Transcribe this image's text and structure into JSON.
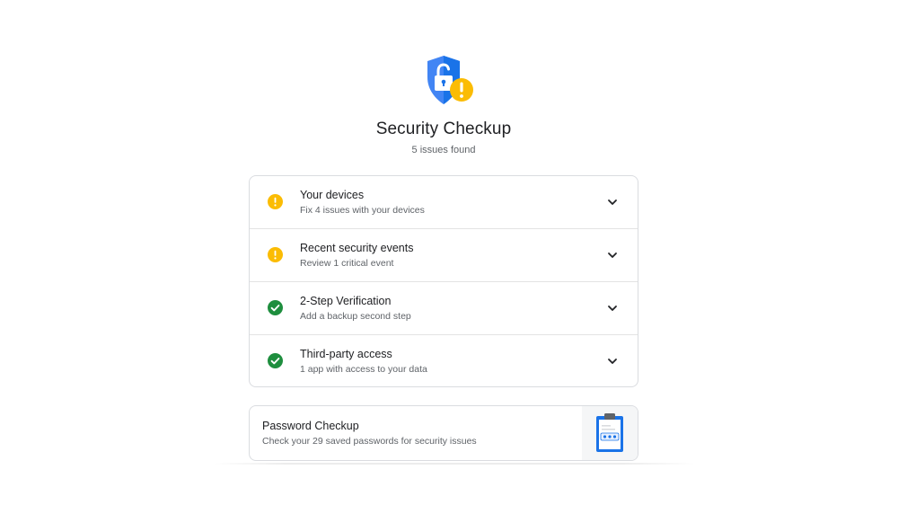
{
  "header": {
    "icon": "shield-lock-warning-icon",
    "title": "Security Checkup",
    "subtitle": "5 issues found"
  },
  "checks": [
    {
      "title": "Your devices",
      "description": "Fix 4 issues with your devices",
      "status": "warning"
    },
    {
      "title": "Recent security events",
      "description": "Review 1 critical event",
      "status": "warning"
    },
    {
      "title": "2-Step Verification",
      "description": "Add a backup second step",
      "status": "ok"
    },
    {
      "title": "Third-party access",
      "description": "1 app with access to your data",
      "status": "ok"
    }
  ],
  "password_checkup": {
    "title": "Password Checkup",
    "description": "Check your 29 saved passwords for security issues",
    "icon": "clipboard-password-icon"
  },
  "colors": {
    "warning": "#fbbc04",
    "ok": "#1e8e3e",
    "shield": "#1a73e8",
    "text_primary": "#202124",
    "text_secondary": "#5f6368"
  }
}
